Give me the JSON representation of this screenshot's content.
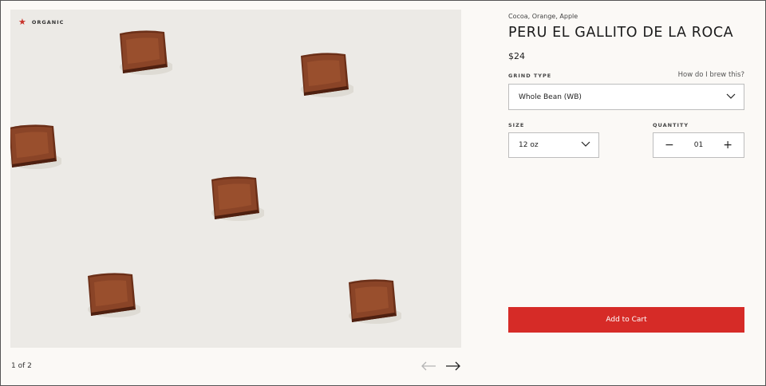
{
  "gallery": {
    "badge": "ORGANIC",
    "pager_text": "1 of 2",
    "prev_icon": "arrow-left-icon",
    "next_icon": "arrow-right-icon"
  },
  "product": {
    "tasting_notes": "Cocoa, Orange, Apple",
    "title": "PERU EL GALLITO DE LA ROCA",
    "price": "$24",
    "grind": {
      "label": "GRIND TYPE",
      "help_link": "How do I brew this?",
      "selected": "Whole Bean (WB)"
    },
    "size": {
      "label": "SIZE",
      "selected": "12 oz"
    },
    "quantity": {
      "label": "QUANTITY",
      "value": "01",
      "decrement": "−",
      "increment": "+"
    },
    "add_to_cart": "Add to Cart"
  },
  "colors": {
    "page_bg": "#fbf9f6",
    "image_bg": "#eceae6",
    "accent": "#d62b27",
    "chocolate": "#7a3a20"
  }
}
